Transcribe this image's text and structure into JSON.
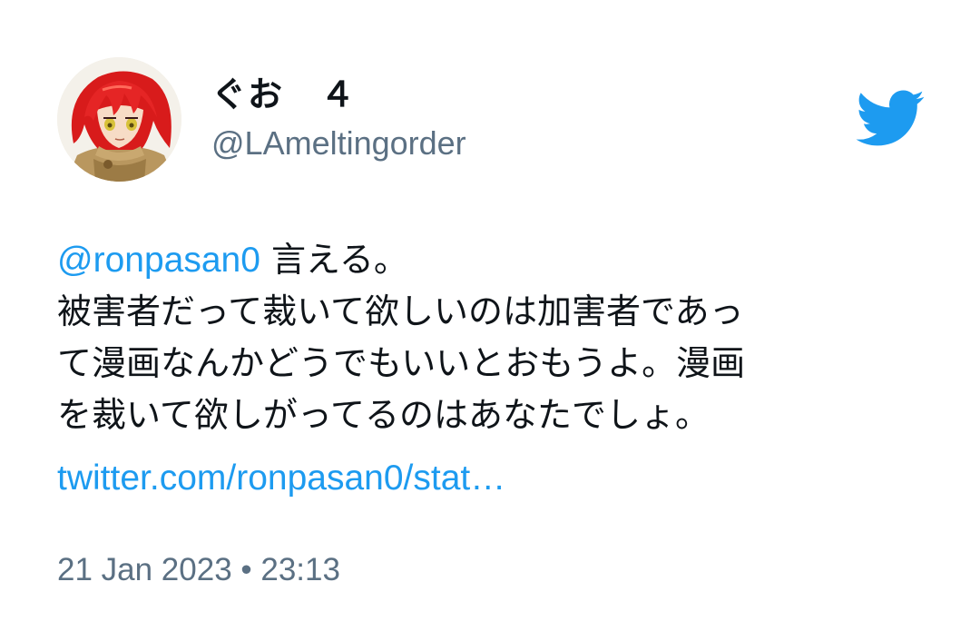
{
  "tweet": {
    "author": {
      "display_name": "ぐお　４",
      "handle": "@LAmeltingorder",
      "avatar_icon": "anime-avatar-red-hair-icon"
    },
    "logo_icon": "twitter-bird-icon",
    "body": {
      "mention": "@ronpasan0",
      "first_line_text": " 言える。",
      "lines": [
        "被害者だって裁いて欲しいのは加害者であっ",
        "て漫画なんかどうでもいいとおもうよ。漫画",
        "を裁いて欲しがってるのはあなたでしょ。"
      ]
    },
    "link_text": "twitter.com/ronpasan0/stat…",
    "timestamp": "21 Jan 2023 • 23:13"
  },
  "colors": {
    "link": "#1d9bf0",
    "secondary_text": "#5b7083",
    "primary_text": "#0f1419",
    "background": "#ffffff"
  }
}
